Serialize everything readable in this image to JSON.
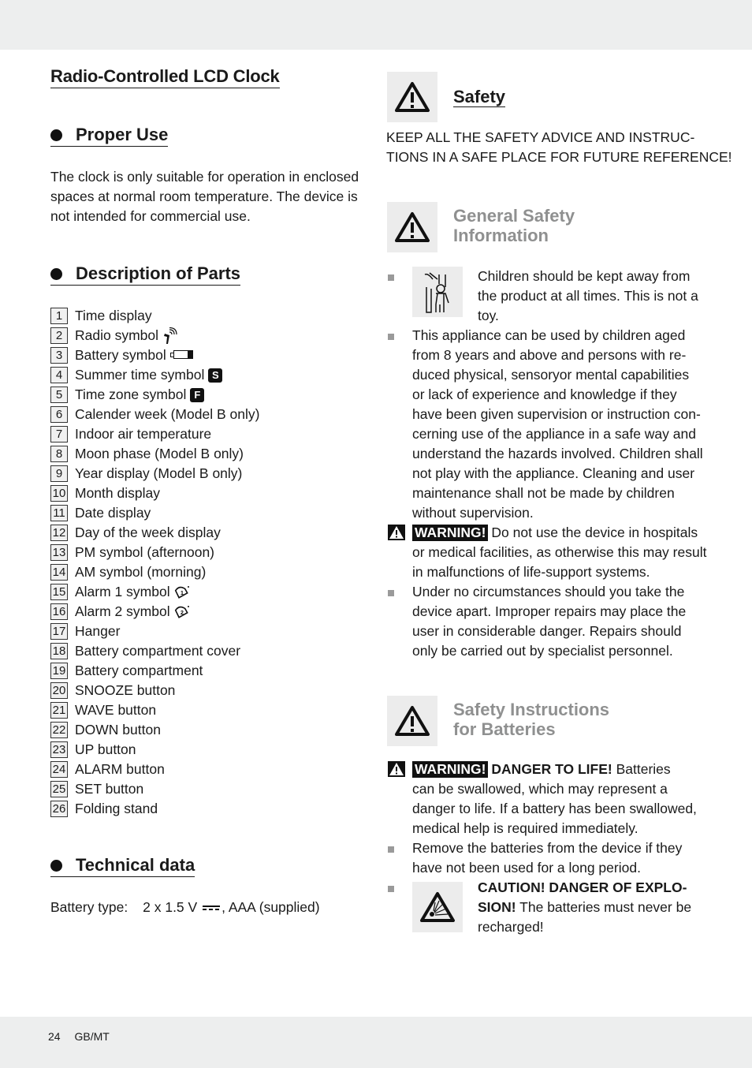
{
  "document": {
    "title": "Radio-Controlled LCD Clock",
    "footer": {
      "page_number": "24",
      "locale": "GB/MT"
    }
  },
  "left": {
    "proper_use": {
      "heading": "Proper Use",
      "lines": [
        "The clock is only suitable for operation in enclosed",
        "spaces at normal room temperature. The device is",
        "not intended for commercial use."
      ]
    },
    "parts": {
      "heading": "Description of Parts",
      "items": [
        {
          "num": "1",
          "label": "Time display",
          "icon": ""
        },
        {
          "num": "2",
          "label": "Radio symbol",
          "icon": "radio-antenna-icon"
        },
        {
          "num": "3",
          "label": "Battery symbol",
          "icon": "battery-icon"
        },
        {
          "num": "4",
          "label": "Summer time symbol",
          "icon": "S"
        },
        {
          "num": "5",
          "label": "Time zone symbol",
          "icon": "F"
        },
        {
          "num": "6",
          "label": "Calender week (Model B only)",
          "icon": ""
        },
        {
          "num": "7",
          "label": "Indoor air temperature",
          "icon": ""
        },
        {
          "num": "8",
          "label": "Moon phase (Model B only)",
          "icon": ""
        },
        {
          "num": "9",
          "label": "Year display (Model B only)",
          "icon": ""
        },
        {
          "num": "10",
          "label": "Month display",
          "icon": ""
        },
        {
          "num": "11",
          "label": "Date display",
          "icon": ""
        },
        {
          "num": "12",
          "label": "Day of the week display",
          "icon": ""
        },
        {
          "num": "13",
          "label": "PM symbol (afternoon)",
          "icon": ""
        },
        {
          "num": "14",
          "label": "AM symbol (morning)",
          "icon": ""
        },
        {
          "num": "15",
          "label": "Alarm 1 symbol",
          "icon": "alarm-bell-1-icon"
        },
        {
          "num": "16",
          "label": "Alarm 2 symbol",
          "icon": "alarm-bell-2-icon"
        },
        {
          "num": "17",
          "label": "Hanger",
          "icon": ""
        },
        {
          "num": "18",
          "label": "Battery compartment cover",
          "icon": ""
        },
        {
          "num": "19",
          "label": "Battery compartment",
          "icon": ""
        },
        {
          "num": "20",
          "label": "SNOOZE button",
          "icon": ""
        },
        {
          "num": "21",
          "label": "WAVE button",
          "icon": ""
        },
        {
          "num": "22",
          "label": "DOWN button",
          "icon": ""
        },
        {
          "num": "23",
          "label": "UP button",
          "icon": ""
        },
        {
          "num": "24",
          "label": "ALARM button",
          "icon": ""
        },
        {
          "num": "25",
          "label": "SET button",
          "icon": ""
        },
        {
          "num": "26",
          "label": "Folding stand",
          "icon": ""
        }
      ]
    },
    "technical": {
      "heading": "Technical data",
      "battery_label": "Battery type:",
      "battery_value_pre": "2 x 1.5 V",
      "battery_value_post": ", AAA (supplied)"
    }
  },
  "right": {
    "safety": {
      "heading": "Safety",
      "lines": [
        "KEEP ALL THE SAFETY ADVICE AND INSTRUC-",
        "TIONS IN A SAFE PLACE FOR FUTURE REFERENCE!"
      ]
    },
    "general": {
      "heading_line1": "General Safety",
      "heading_line2": "Information",
      "children_lines": [
        "Children should be kept away from",
        "the product at all times. This is not a",
        "toy."
      ],
      "appliance_lines": [
        "This appliance can be used by children aged",
        "from 8 years and above and persons with re-",
        "duced physical, sensoryor mental capabilities",
        "or lack of experience and knowledge if they",
        "have been given supervision or instruction con-",
        "cerning use of the appliance in a safe way and",
        "understand the hazards involved. Children shall",
        "not play with the appliance. Cleaning and user",
        "maintenance shall not be made by children",
        "without supervision."
      ],
      "warning_label": "WARNING!",
      "warning_first": "Do not use the device in hospitals",
      "warning_lines": [
        "or medical facilities, as otherwise this may result",
        "in malfunctions of life-support systems."
      ],
      "repair_lines": [
        "Under no circumstances should you take the",
        "device apart. Improper repairs may place the",
        "user in considerable danger. Repairs should",
        "only be carried out by specialist personnel."
      ]
    },
    "batteries": {
      "heading_line1": "Safety Instructions",
      "heading_line2": "for Batteries",
      "warning_label": "WARNING!",
      "warning_bold": "DANGER TO LIFE!",
      "warning_first": "Batteries",
      "warning_lines": [
        "can be swallowed, which may represent a",
        "danger to life. If a battery has been swallowed,",
        "medical help is required immediately."
      ],
      "remove_lines": [
        "Remove the batteries from the device if they",
        "have not been used for a long period."
      ],
      "caution_bold_1": "CAUTION! DANGER OF EXPLO-",
      "caution_bold_2": "SION!",
      "caution_rest": "The batteries must never be",
      "caution_last": "recharged!"
    }
  }
}
